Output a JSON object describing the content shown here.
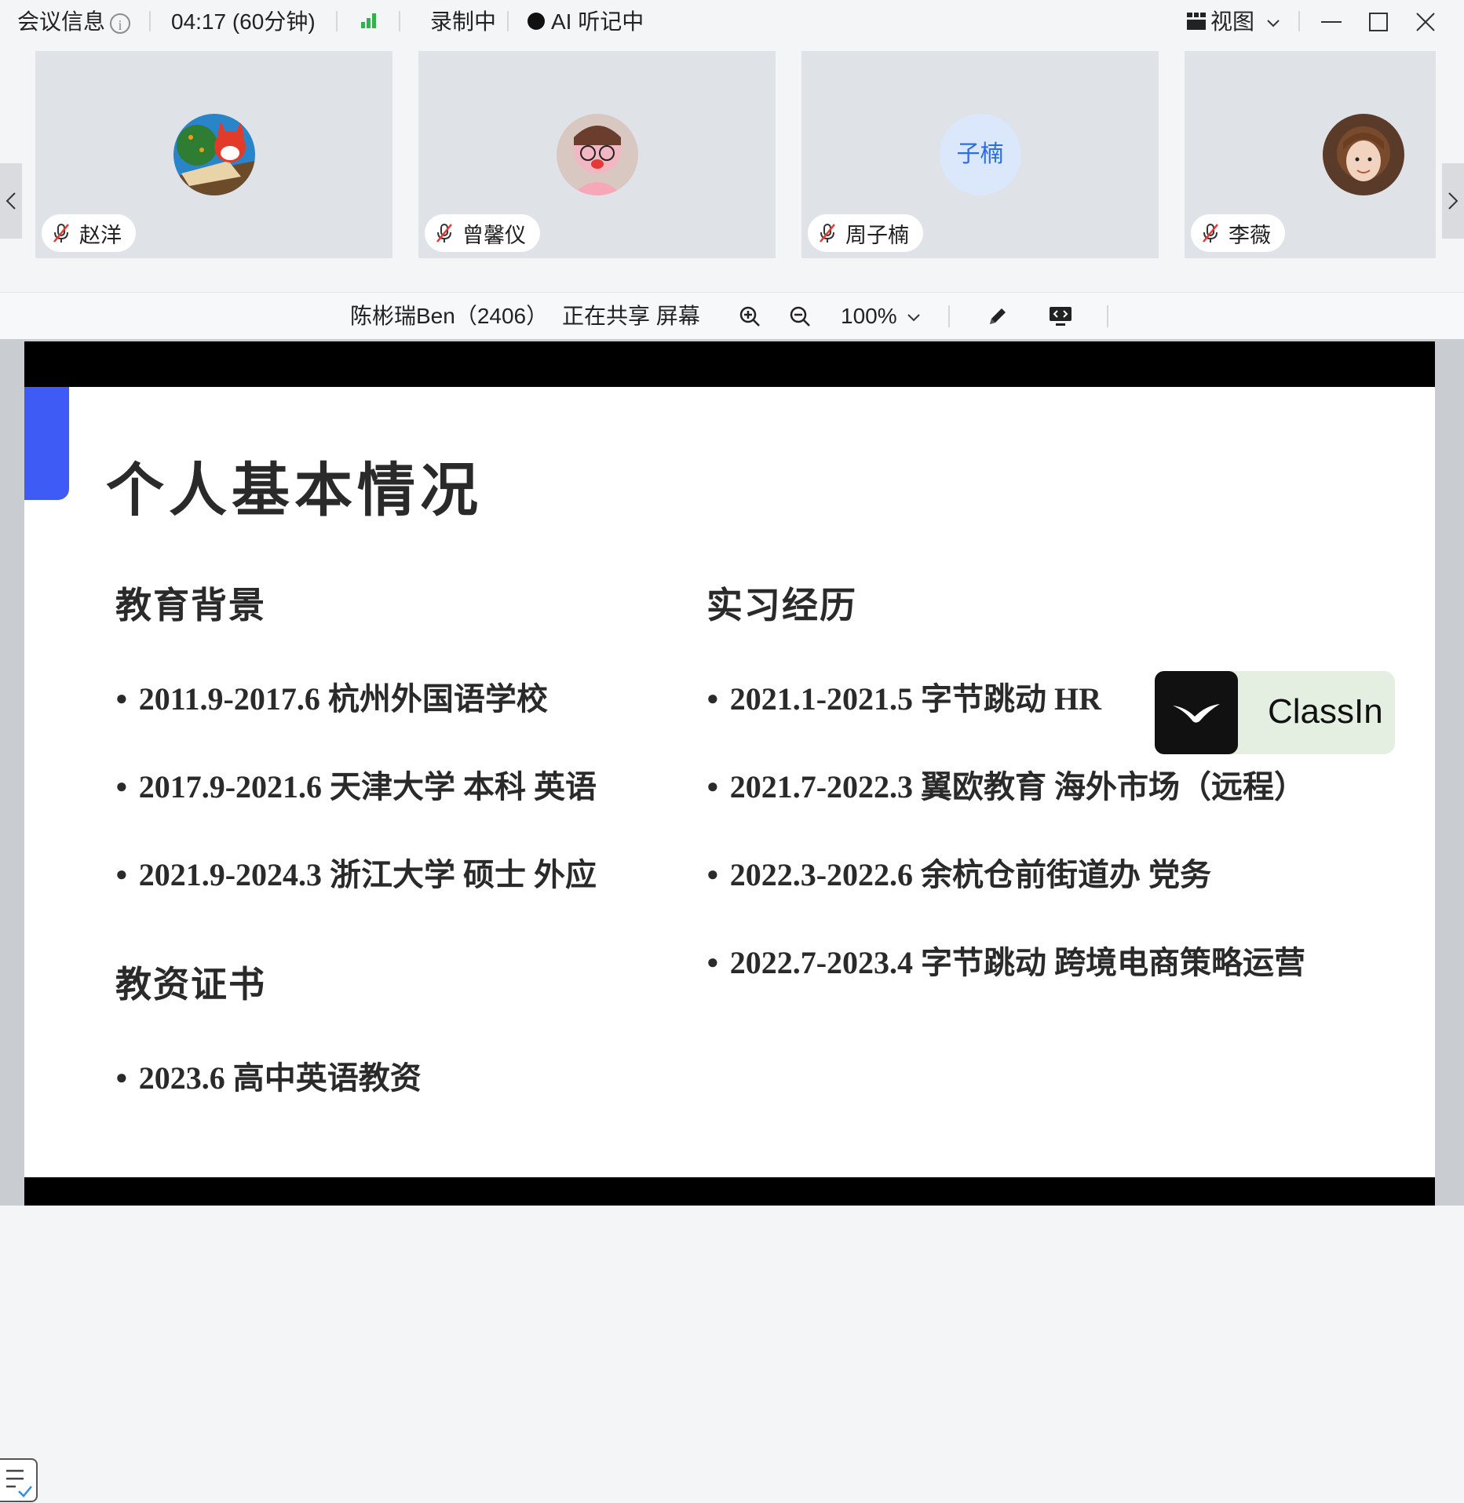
{
  "topbar": {
    "meeting_info": "会议信息",
    "info_icon_glyph": "i",
    "timer": "04:17 (60分钟)",
    "signal_icon": "signal-bars-icon",
    "recording": "录制中",
    "ai_status": "AI 听记中",
    "view_label": "视图"
  },
  "participants": [
    {
      "name": "赵洋",
      "avatar_type": "image",
      "avatar_desc": "fox-avatar"
    },
    {
      "name": "曾馨仪",
      "avatar_type": "image",
      "avatar_desc": "pink-doll-avatar"
    },
    {
      "name": "周子楠",
      "avatar_type": "text",
      "avatar_text": "子楠"
    },
    {
      "name": "李薇",
      "avatar_type": "image",
      "avatar_desc": "girl-photo-avatar"
    }
  ],
  "sharebar": {
    "presenter": "陈彬瑞Ben（2406）",
    "sharing_text": "正在共享 屏幕",
    "zoom_level": "100%"
  },
  "slide": {
    "title": "个人基本情况",
    "education": {
      "heading": "教育背景",
      "items": [
        "2011.9-2017.6 杭州外国语学校",
        "2017.9-2021.6 天津大学 本科 英语",
        "2021.9-2024.3 浙江大学 硕士 外应"
      ]
    },
    "certificates": {
      "heading": "教资证书",
      "items": [
        "2023.6 高中英语教资"
      ]
    },
    "internship": {
      "heading": "实习经历",
      "items": [
        "2021.1-2021.5 字节跳动 HR",
        "2021.7-2022.3 翼欧教育 海外市场（远程）",
        "2022.3-2022.6 余杭仓前街道办 党务",
        "2022.7-2023.4 字节跳动 跨境电商策略运营"
      ]
    },
    "overlay_logo_text": "ClassIn",
    "accent_color": "#3f5bf6"
  },
  "colors": {
    "signal_green": "#2fb34a",
    "mic_muted_red": "#e53935"
  }
}
